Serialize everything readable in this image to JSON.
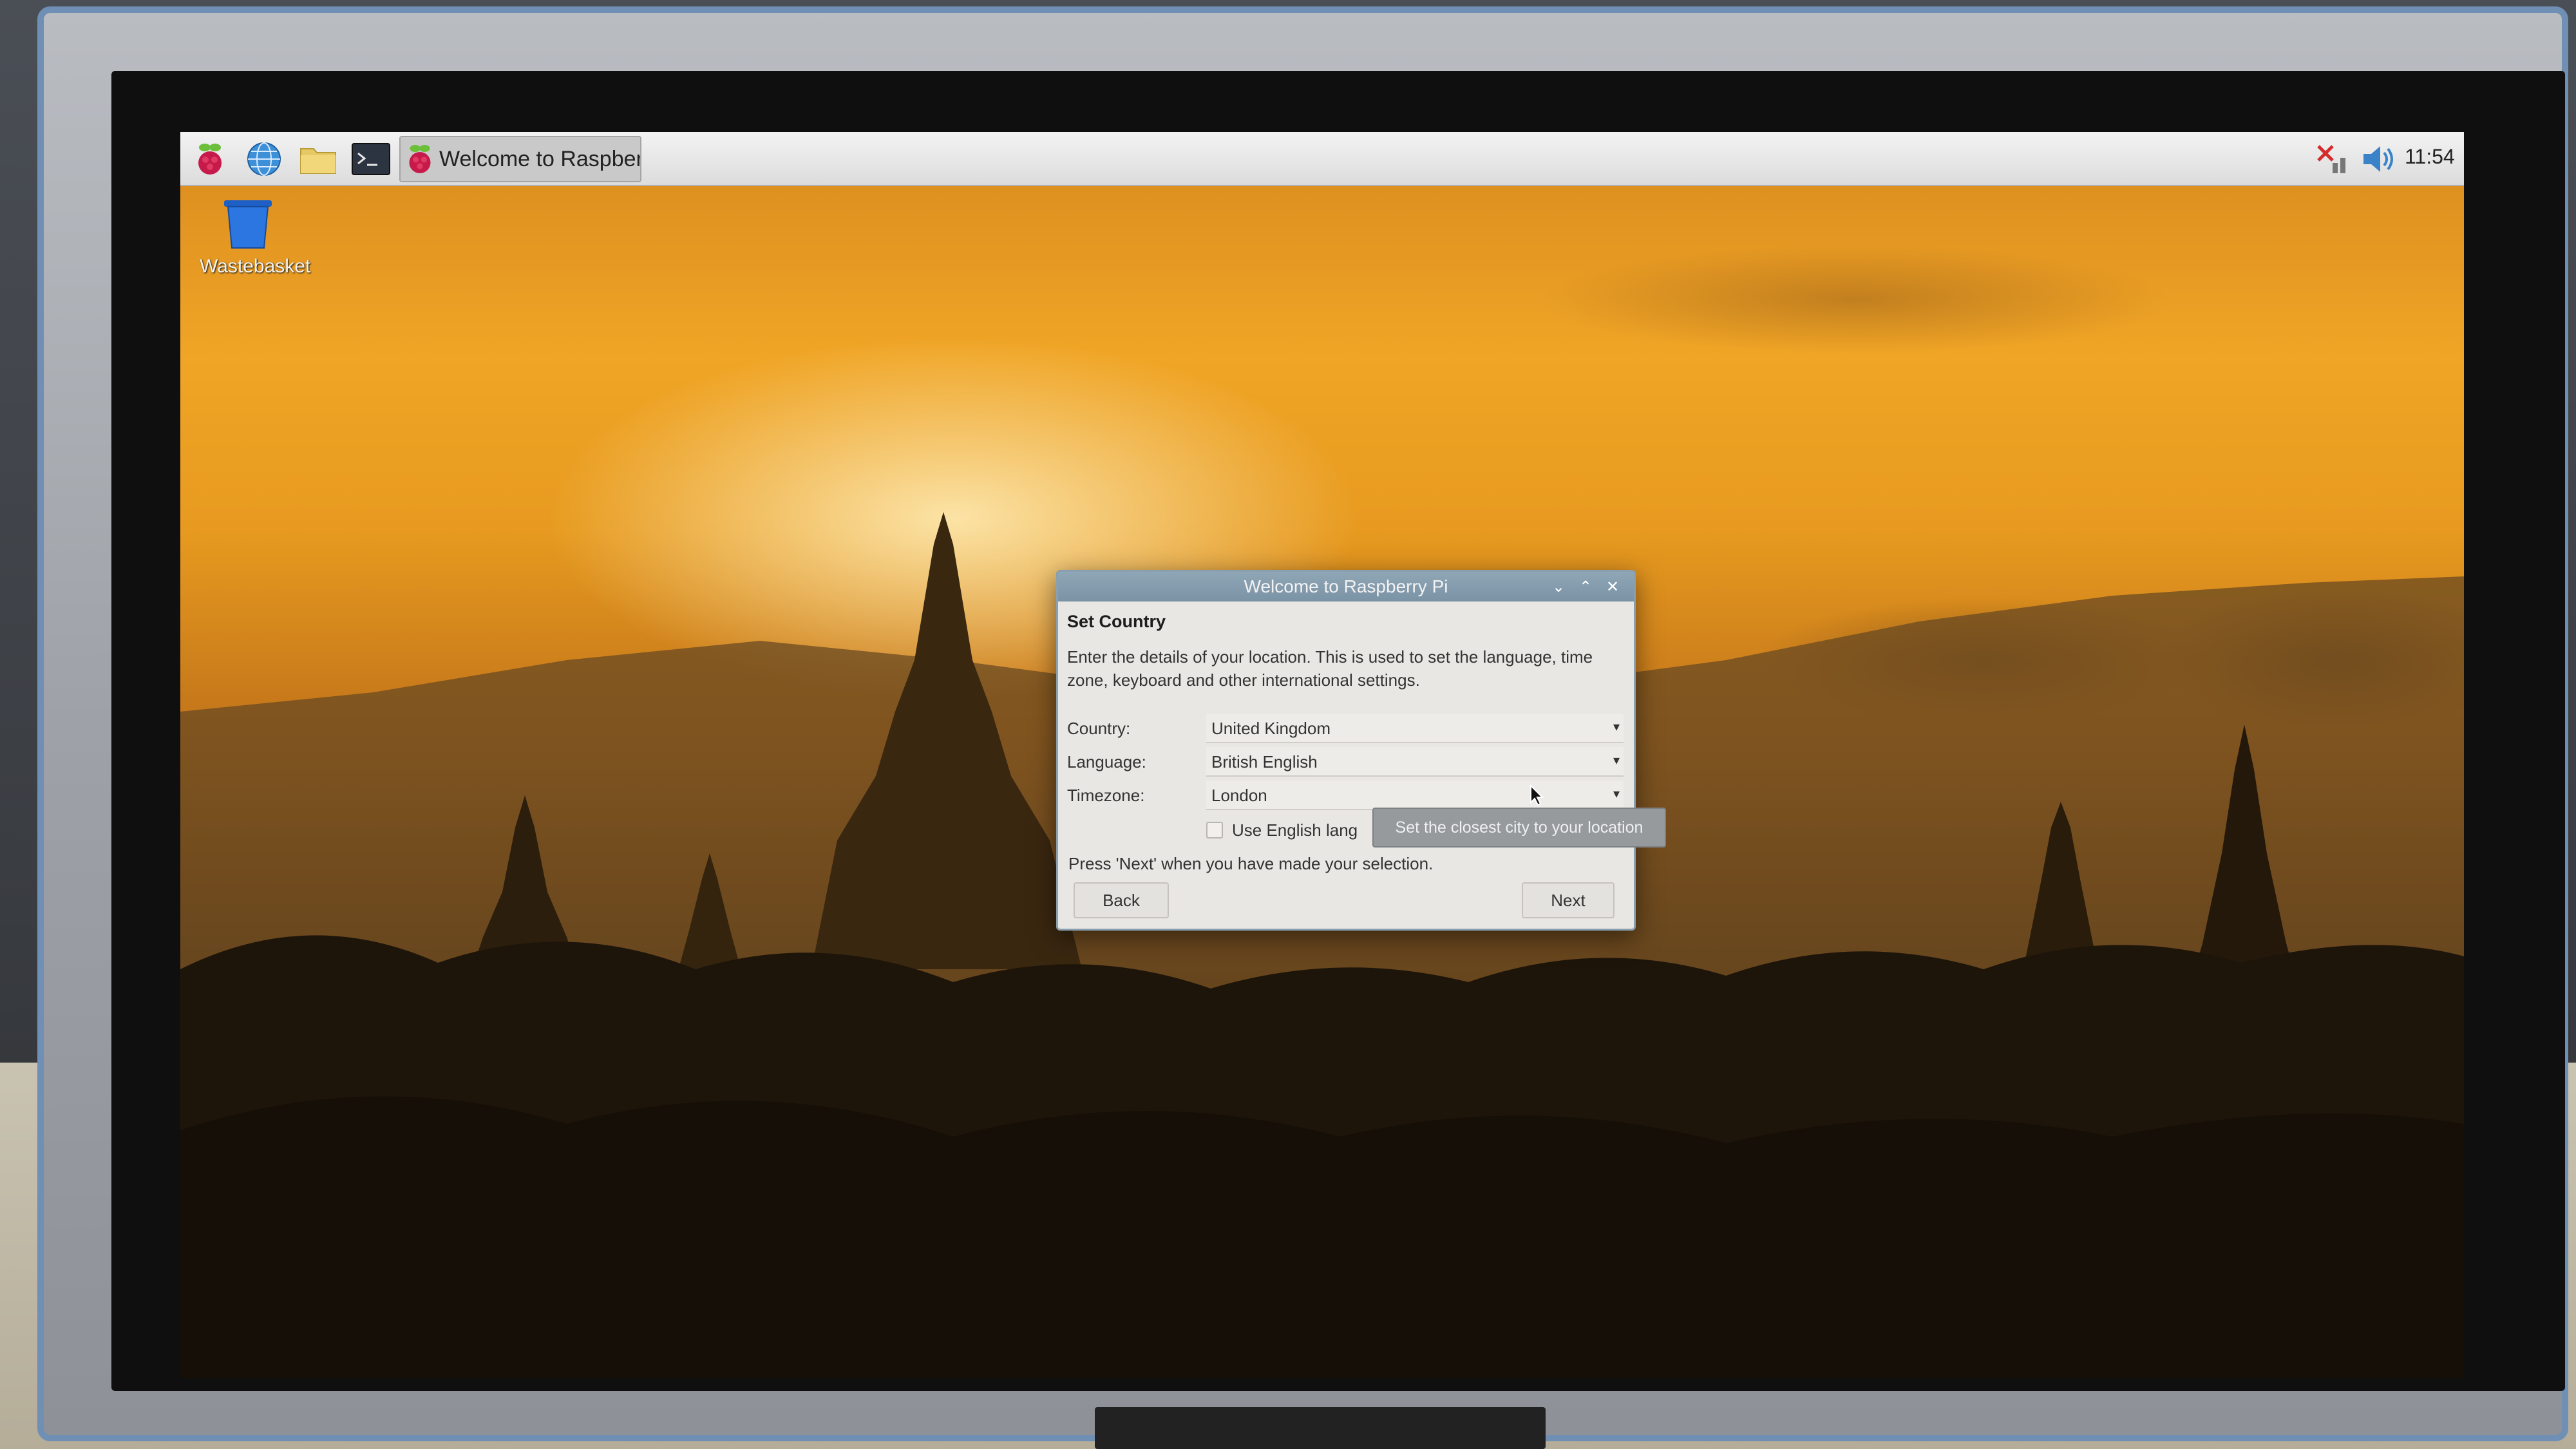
{
  "taskbar": {
    "window_button_label": "Welcome to Raspberr...",
    "clock": "11:54",
    "icons": [
      "raspberry-menu-icon",
      "web-browser-icon",
      "file-manager-icon",
      "terminal-icon",
      "network-disconnected-icon",
      "volume-icon"
    ]
  },
  "desktop": {
    "wastebasket_label": "Wastebasket"
  },
  "dialog": {
    "title": "Welcome to Raspberry Pi",
    "heading": "Set Country",
    "description": "Enter the details of your location. This is used to set the language, time zone, keyboard and other international settings.",
    "country_label": "Country:",
    "country_value": "United Kingdom",
    "language_label": "Language:",
    "language_value": "British English",
    "timezone_label": "Timezone:",
    "timezone_value": "London",
    "english_checkbox_label": "Use English lang",
    "english_checked": false,
    "tooltip": "Set the closest city to your location",
    "hint": "Press 'Next' when you have made your selection.",
    "back_label": "Back",
    "next_label": "Next"
  },
  "colors": {
    "titlebar": "#7a93a5",
    "dialog_bg": "#e9e7e3",
    "sky_top": "#d98a1e",
    "sky_glow": "#fff0be"
  }
}
